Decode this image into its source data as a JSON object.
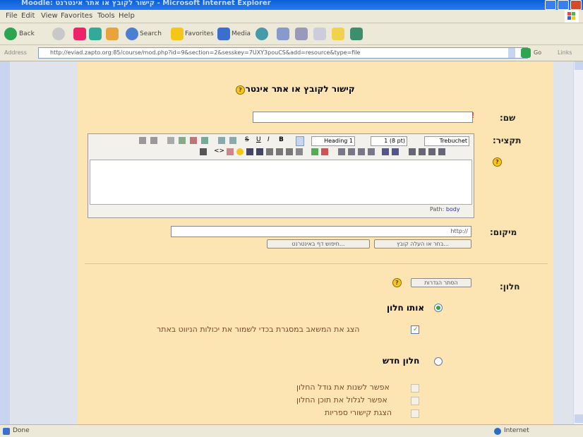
{
  "window": {
    "title": "Moodle: קישור לקובץ או אתר אינטרנט - Microsoft Internet Explorer"
  },
  "menu": [
    "File",
    "Edit",
    "View",
    "Favorites",
    "Tools",
    "Help"
  ],
  "toolbar": {
    "back": "Back",
    "search": "Search",
    "favorites": "Favorites",
    "media": "Media"
  },
  "address": {
    "label": "Address",
    "url": "http://eviad.zapto.org:85/course/mod.php?id=9&section=2&sesskey=7UXY3pouCS&add=resource&type=file",
    "go": "Go",
    "links": "Links"
  },
  "form": {
    "heading": "קישור לקובץ או אתר אינטרנט",
    "name_label": "שם:",
    "summary_label": "תקציר:",
    "location_label": "מיקום:",
    "location_value": "http://",
    "choose_file_button": "בחר או העלה קובץ...",
    "search_web_button": "חיפוש דף באינטרנט...",
    "window_label": "חלון:",
    "hide_settings_button": "הסתר הגדרות",
    "same_window_label": "אותו חלון",
    "show_in_frame_label": "הצג את המשאב במסגרת בכדי לשמור את יכולות הניווט באתר",
    "new_window_label": "חלון חדש",
    "allow_resize_label": "אפשר לשנות את גודל החלון",
    "allow_scroll_label": "אפשר לגלול את תוכן החלון",
    "directory_links_label": "הצגת קישורי ספריות"
  },
  "editor": {
    "font": "Trebuchet",
    "size": "1 (8 pt)",
    "style": "Heading 1",
    "path_label": "Path:",
    "path_value": "body"
  },
  "status": {
    "left": "Done",
    "zone": "Internet"
  }
}
